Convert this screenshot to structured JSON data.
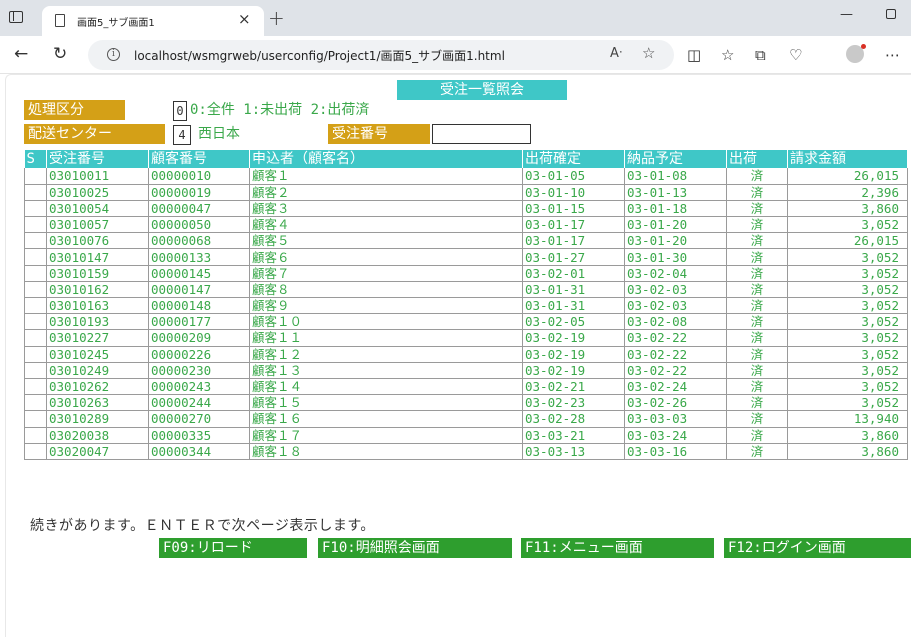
{
  "browser": {
    "tab_title": "画面5_サブ画面1",
    "url": "localhost/wsmgrweb/userconfig/Project1/画面5_サブ画面1.html",
    "read_aloud_icon": "read-aloud-icon",
    "favorites_icon": "star-icon"
  },
  "screen": {
    "title": "受注一覧照会",
    "process_label": "処理区分",
    "process_value": "0",
    "process_hint": "0:全件 1:未出荷 2:出荷済",
    "center_label": "配送センター",
    "center_value": "4",
    "center_name": "西日本",
    "order_no_label": "受注番号",
    "order_no_value": ""
  },
  "table": {
    "headers": [
      "S",
      "受注番号",
      "顧客番号",
      "申込者（顧客名）",
      "出荷確定",
      "納品予定",
      "出荷",
      "請求金額"
    ],
    "rows": [
      [
        "",
        "03010011",
        "00000010",
        "顧客１",
        "03-01-05",
        "03-01-08",
        "済",
        "26,015"
      ],
      [
        "",
        "03010025",
        "00000019",
        "顧客２",
        "03-01-10",
        "03-01-13",
        "済",
        "2,396"
      ],
      [
        "",
        "03010054",
        "00000047",
        "顧客３",
        "03-01-15",
        "03-01-18",
        "済",
        "3,860"
      ],
      [
        "",
        "03010057",
        "00000050",
        "顧客４",
        "03-01-17",
        "03-01-20",
        "済",
        "3,052"
      ],
      [
        "",
        "03010076",
        "00000068",
        "顧客５",
        "03-01-17",
        "03-01-20",
        "済",
        "26,015"
      ],
      [
        "",
        "03010147",
        "00000133",
        "顧客６",
        "03-01-27",
        "03-01-30",
        "済",
        "3,052"
      ],
      [
        "",
        "03010159",
        "00000145",
        "顧客７",
        "03-02-01",
        "03-02-04",
        "済",
        "3,052"
      ],
      [
        "",
        "03010162",
        "00000147",
        "顧客８",
        "03-01-31",
        "03-02-03",
        "済",
        "3,052"
      ],
      [
        "",
        "03010163",
        "00000148",
        "顧客９",
        "03-01-31",
        "03-02-03",
        "済",
        "3,052"
      ],
      [
        "",
        "03010193",
        "00000177",
        "顧客１０",
        "03-02-05",
        "03-02-08",
        "済",
        "3,052"
      ],
      [
        "",
        "03010227",
        "00000209",
        "顧客１１",
        "03-02-19",
        "03-02-22",
        "済",
        "3,052"
      ],
      [
        "",
        "03010245",
        "00000226",
        "顧客１２",
        "03-02-19",
        "03-02-22",
        "済",
        "3,052"
      ],
      [
        "",
        "03010249",
        "00000230",
        "顧客１３",
        "03-02-19",
        "03-02-22",
        "済",
        "3,052"
      ],
      [
        "",
        "03010262",
        "00000243",
        "顧客１４",
        "03-02-21",
        "03-02-24",
        "済",
        "3,052"
      ],
      [
        "",
        "03010263",
        "00000244",
        "顧客１５",
        "03-02-23",
        "03-02-26",
        "済",
        "3,052"
      ],
      [
        "",
        "03010289",
        "00000270",
        "顧客１６",
        "03-02-28",
        "03-03-03",
        "済",
        "13,940"
      ],
      [
        "",
        "03020038",
        "00000335",
        "顧客１７",
        "03-03-21",
        "03-03-24",
        "済",
        "3,860"
      ],
      [
        "",
        "03020047",
        "00000344",
        "顧客１８",
        "03-03-13",
        "03-03-16",
        "済",
        "3,860"
      ]
    ]
  },
  "message": "続きがあります。ＥＮＴＥＲで次ページ表示します。",
  "fkeys": [
    {
      "label": "F09:リロード"
    },
    {
      "label": "F10:明細照会画面"
    },
    {
      "label": "F11:メニュー画面"
    },
    {
      "label": "F12:ログイン画面"
    }
  ],
  "colors": {
    "title_bg": "#3fc7c7",
    "label_bg": "#d4a017",
    "fkey_bg": "#2e9e2e",
    "cell_text": "#3aa84a"
  }
}
